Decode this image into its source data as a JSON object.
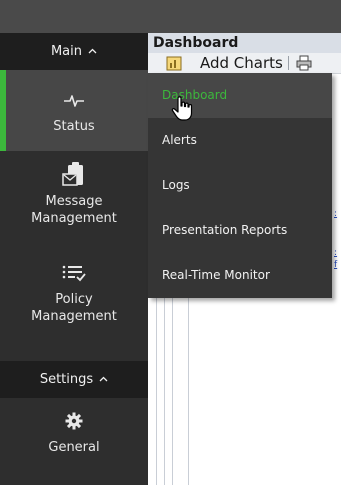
{
  "sidebar": {
    "main_header": "Main",
    "main_chevron": "^",
    "items": [
      {
        "label": "Status",
        "icon": "pulse-icon"
      },
      {
        "label": "Message\nManagement",
        "icon": "clipboard-mail-icon"
      },
      {
        "label": "Policy\nManagement",
        "icon": "list-check-icon"
      }
    ],
    "settings_header": "Settings",
    "settings_chevron": "^",
    "settings_items": [
      {
        "label": "General",
        "icon": "gear-icon"
      }
    ]
  },
  "content": {
    "title": "Dashboard",
    "toolbar": {
      "add_charts_label": "Add Charts"
    }
  },
  "menu": {
    "items": [
      {
        "label": "Dashboard",
        "highlighted": true
      },
      {
        "label": "Alerts"
      },
      {
        "label": "Logs"
      },
      {
        "label": "Presentation Reports"
      },
      {
        "label": "Real-Time Monitor"
      }
    ]
  },
  "colors": {
    "accent": "#3cb83c",
    "sidebar_bg": "#2e2e2e",
    "header_bg": "#1e1e1e",
    "menu_bg": "#353535"
  }
}
